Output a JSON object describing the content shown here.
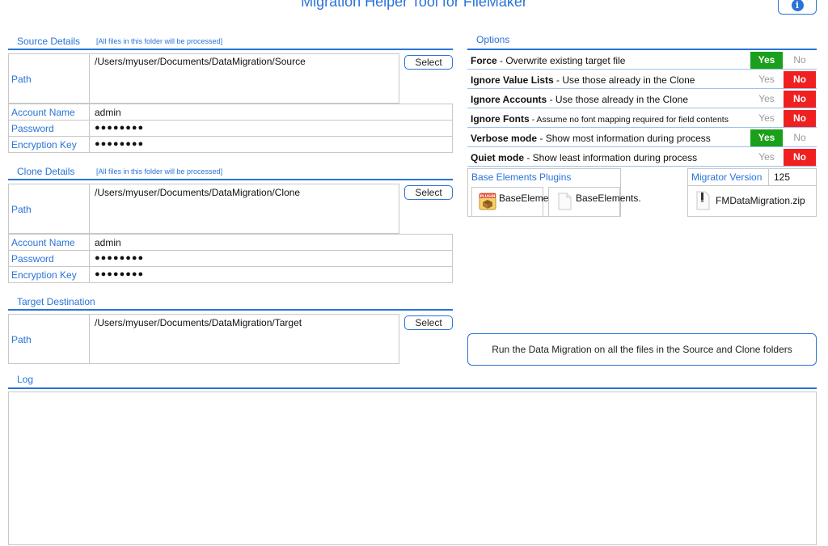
{
  "app": {
    "title": "Migration Helper Tool for FileMaker",
    "info_icon": "i"
  },
  "source": {
    "title": "Source Details",
    "note": "[All files in this folder will be processed]",
    "path_label": "Path",
    "path": "/Users/myuser/Documents/DataMigration/Source",
    "select_label": "Select",
    "account_label": "Account Name",
    "account": "admin",
    "password_label": "Password",
    "password": "●●●●●●●●",
    "key_label": "Encryption Key",
    "key": "●●●●●●●●"
  },
  "clone": {
    "title": "Clone Details",
    "note": "[All files in this folder will be processed]",
    "path_label": "Path",
    "path": "/Users/myuser/Documents/DataMigration/Clone",
    "select_label": "Select",
    "account_label": "Account Name",
    "account": "admin",
    "password_label": "Password",
    "password": "●●●●●●●●",
    "key_label": "Encryption Key",
    "key": "●●●●●●●●"
  },
  "target": {
    "title": "Target Destination",
    "path_label": "Path",
    "path": "/Users/myuser/Documents/DataMigration/Target",
    "select_label": "Select"
  },
  "options": {
    "title": "Options",
    "yes": "Yes",
    "no": "No",
    "rows": [
      {
        "name": "Force",
        "desc": " - Overwrite existing target file",
        "value": "Yes"
      },
      {
        "name": "Ignore Value Lists",
        "desc": " - Use those already in the Clone",
        "value": "No"
      },
      {
        "name": "Ignore Accounts",
        "desc": " - Use those already in the Clone",
        "value": "No"
      },
      {
        "name": "Ignore Fonts",
        "desc": " - Assume no font mapping required for field contents",
        "value": "No"
      },
      {
        "name": "Verbose mode",
        "desc": " - Show most information during process",
        "value": "Yes"
      },
      {
        "name": "Quiet mode",
        "desc": " - Show least information during process",
        "value": "No"
      }
    ]
  },
  "plugins": {
    "title": "Base Elements Plugins",
    "items": [
      {
        "name": "BaseElements.",
        "icon": "plugin-package-icon",
        "icon_label": "PLUGIN"
      },
      {
        "name": "BaseElements.",
        "icon": "file-icon"
      }
    ]
  },
  "migrator": {
    "label": "Migrator Version",
    "version": "125",
    "file": "FMDataMigration.zip"
  },
  "run": {
    "label": "Run the Data Migration on all the files in the Source and Clone folders"
  },
  "log": {
    "title": "Log",
    "content": ""
  },
  "colors": {
    "accent": "#2a73d8",
    "yes_on": "#1aa01a",
    "no_on": "#f02020"
  }
}
